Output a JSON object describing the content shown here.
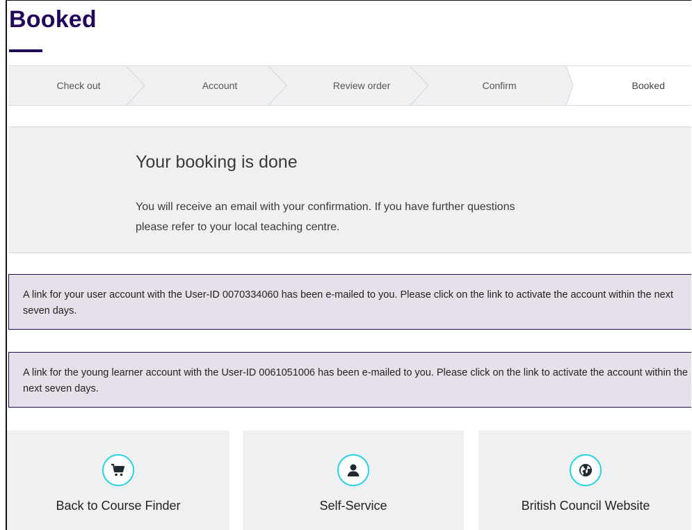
{
  "page": {
    "title": "Booked"
  },
  "steps": [
    {
      "label": "Check out",
      "active": false
    },
    {
      "label": "Account",
      "active": false
    },
    {
      "label": "Review order",
      "active": false
    },
    {
      "label": "Confirm",
      "active": false
    },
    {
      "label": "Booked",
      "active": true
    }
  ],
  "confirmation": {
    "heading": "Your booking is done",
    "text": "You will receive an email with your confirmation. If you have further questions please refer to your local teaching centre."
  },
  "notices": [
    {
      "text": "A link for your user account with the User-ID 0070334060 has been e-mailed to you. Please click on the link to activate the account within the next seven days."
    },
    {
      "text": "A link for the young learner account with the User-ID 0061051006 has been e-mailed to you. Please click on the link to activate the account within the next seven days."
    }
  ],
  "tiles": [
    {
      "label": "Back to Course Finder",
      "icon": "cart-icon"
    },
    {
      "label": "Self-Service",
      "icon": "person-icon"
    },
    {
      "label": "British Council Website",
      "icon": "globe-icon"
    }
  ],
  "colors": {
    "brand": "#23085a",
    "accent": "#29d3e6",
    "panel": "#eef0f1",
    "notice": "#e6e0ea"
  }
}
